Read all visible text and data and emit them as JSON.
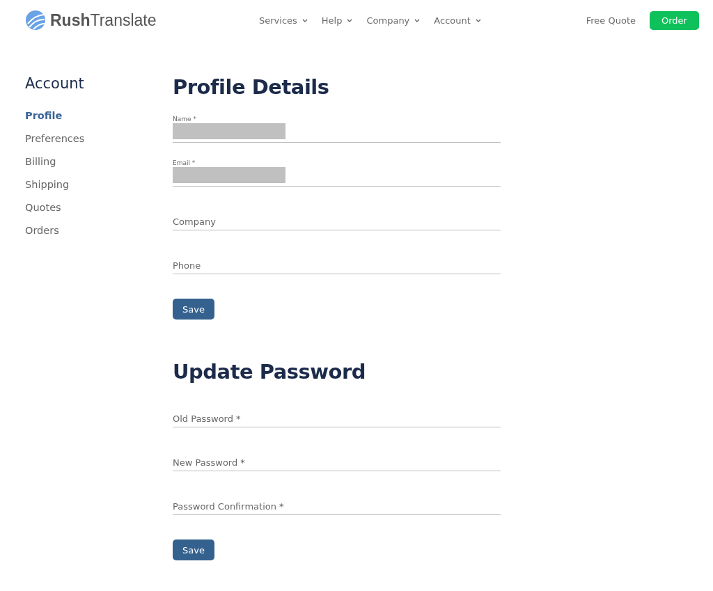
{
  "header": {
    "logo": "**Rush**Translate",
    "nav": [
      {
        "label": "Services"
      },
      {
        "label": "Help"
      },
      {
        "label": "Company"
      },
      {
        "label": "Account"
      }
    ],
    "free_quote": "Free Quote",
    "order": "Order"
  },
  "sidebar": {
    "title": "Account",
    "items": [
      {
        "label": "Profile",
        "selected": true
      },
      {
        "label": "Preferences",
        "selected": false
      },
      {
        "label": "Billing",
        "selected": false
      },
      {
        "label": "Shipping",
        "selected": false
      },
      {
        "label": "Quotes",
        "selected": false
      },
      {
        "label": "Orders",
        "selected": false
      }
    ]
  },
  "sections": [
    {
      "title": "Profile Details",
      "fields": [
        {
          "label": "Name *",
          "kind": "redacted"
        },
        {
          "label": "Email *",
          "kind": "redacted"
        },
        {
          "label": "Company",
          "kind": "empty"
        },
        {
          "label": "Phone",
          "kind": "empty"
        }
      ],
      "button": "Save"
    },
    {
      "title": "Update Password",
      "fields": [
        {
          "label": "Old Password *",
          "kind": "empty"
        },
        {
          "label": "New Password *",
          "kind": "empty"
        },
        {
          "label": "Password Confirmation *",
          "kind": "empty"
        }
      ],
      "button": "Save"
    }
  ]
}
